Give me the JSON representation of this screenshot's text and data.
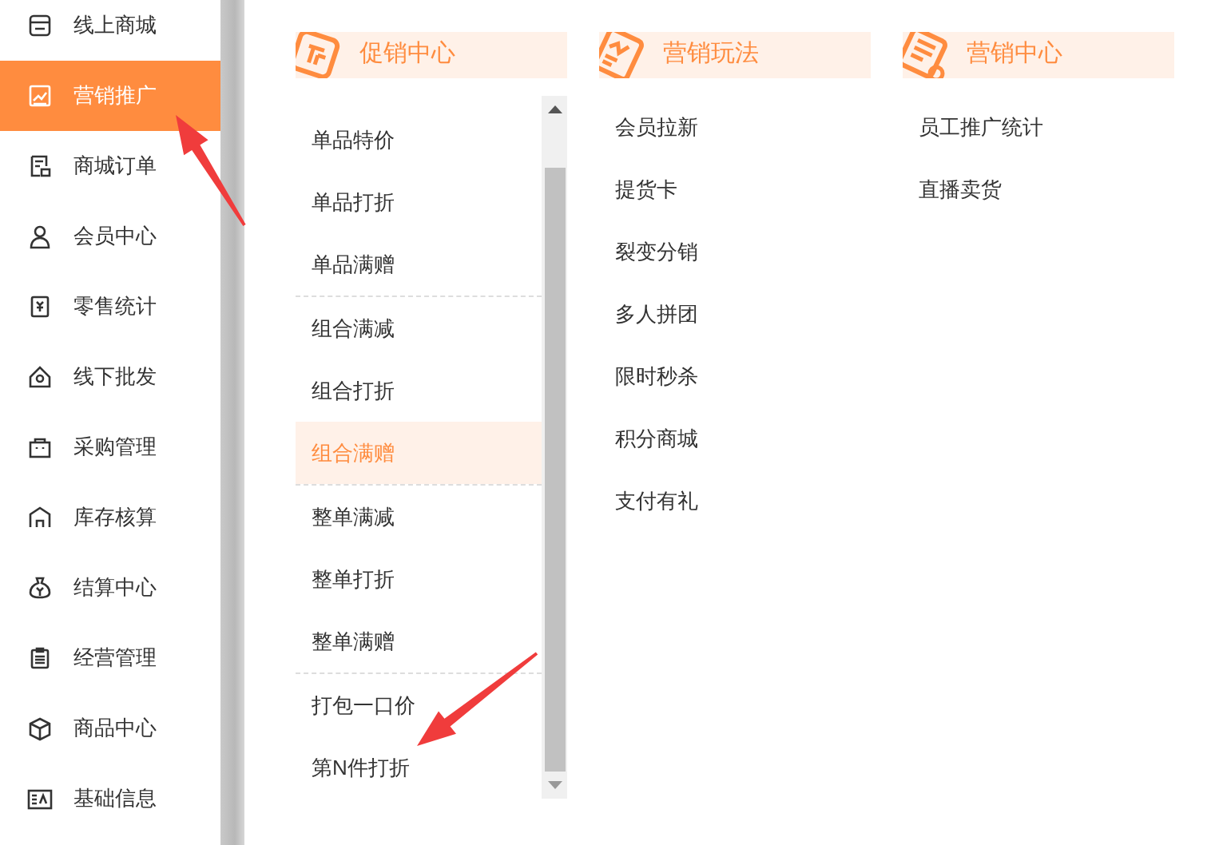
{
  "sidebar": {
    "items": [
      {
        "label": "线上商城",
        "selected": false
      },
      {
        "label": "营销推广",
        "selected": true
      },
      {
        "label": "商城订单",
        "selected": false
      },
      {
        "label": "会员中心",
        "selected": false
      },
      {
        "label": "零售统计",
        "selected": false
      },
      {
        "label": "线下批发",
        "selected": false
      },
      {
        "label": "采购管理",
        "selected": false
      },
      {
        "label": "库存核算",
        "selected": false
      },
      {
        "label": "结算中心",
        "selected": false
      },
      {
        "label": "经营管理",
        "selected": false
      },
      {
        "label": "商品中心",
        "selected": false
      },
      {
        "label": "基础信息",
        "selected": false
      }
    ]
  },
  "panels": [
    {
      "title": "促销中心",
      "groups": [
        {
          "items": [
            {
              "label": "单品特价",
              "selected": false
            },
            {
              "label": "单品打折",
              "selected": false
            },
            {
              "label": "单品满赠",
              "selected": false
            }
          ]
        },
        {
          "items": [
            {
              "label": "组合满减",
              "selected": false
            },
            {
              "label": "组合打折",
              "selected": false
            },
            {
              "label": "组合满赠",
              "selected": true
            }
          ]
        },
        {
          "items": [
            {
              "label": "整单满减",
              "selected": false
            },
            {
              "label": "整单打折",
              "selected": false
            },
            {
              "label": "整单满赠",
              "selected": false
            }
          ]
        },
        {
          "items": [
            {
              "label": "打包一口价",
              "selected": false
            },
            {
              "label": "第N件打折",
              "selected": false
            }
          ]
        }
      ]
    },
    {
      "title": "营销玩法",
      "groups": [
        {
          "items": [
            {
              "label": "会员拉新",
              "selected": false
            },
            {
              "label": "提货卡",
              "selected": false
            },
            {
              "label": "裂变分销",
              "selected": false
            },
            {
              "label": "多人拼团",
              "selected": false
            },
            {
              "label": "限时秒杀",
              "selected": false
            },
            {
              "label": "积分商城",
              "selected": false
            },
            {
              "label": "支付有礼",
              "selected": false
            }
          ]
        }
      ]
    },
    {
      "title": "营销中心",
      "groups": [
        {
          "items": [
            {
              "label": "员工推广统计",
              "selected": false
            },
            {
              "label": "直播卖货",
              "selected": false
            }
          ]
        }
      ]
    }
  ]
}
